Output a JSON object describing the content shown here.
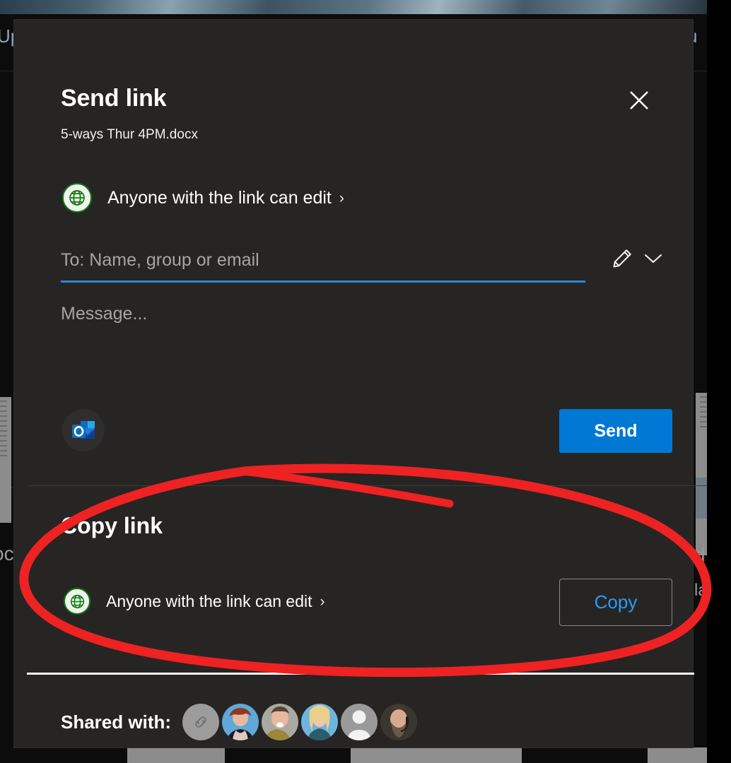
{
  "background": {
    "text_left_fragment": "Up",
    "text_right_fragment": "u",
    "doc_label_left": "oc",
    "doc_label_right_1": "d",
    "doc_label_right_2": "la"
  },
  "dialog": {
    "title": "Send link",
    "file_name": "5-ways Thur 4PM.docx",
    "close_icon": "close-icon",
    "send_section": {
      "permission": {
        "icon": "globe-icon",
        "label": "Anyone with the link can edit",
        "chevron": "›"
      },
      "to_field": {
        "placeholder": "To: Name, group or email",
        "value": "",
        "underline_color": "#2e86d8"
      },
      "edit_icon": "pencil-icon",
      "dropdown_icon": "chevron-down-icon",
      "message_field": {
        "placeholder": "Message...",
        "value": ""
      },
      "outlook_icon": "outlook-icon",
      "send_label": "Send",
      "send_color": "#0078d4"
    },
    "copy_section": {
      "title": "Copy link",
      "permission": {
        "icon": "globe-icon",
        "label": "Anyone with the link can edit",
        "chevron": "›"
      },
      "copy_label": "Copy",
      "copy_text_color": "#2b9bf4"
    },
    "shared_with": {
      "label": "Shared with:",
      "avatars": [
        {
          "name": "link-avatar",
          "type": "link"
        },
        {
          "name": "person-avatar-1",
          "type": "photo"
        },
        {
          "name": "person-avatar-2",
          "type": "photo"
        },
        {
          "name": "person-avatar-3",
          "type": "photo"
        },
        {
          "name": "person-avatar-4",
          "type": "placeholder"
        },
        {
          "name": "person-avatar-5",
          "type": "photo"
        }
      ]
    }
  },
  "annotation": {
    "type": "hand-drawn-ellipse",
    "color": "#ee2222",
    "target": "Copy link"
  }
}
